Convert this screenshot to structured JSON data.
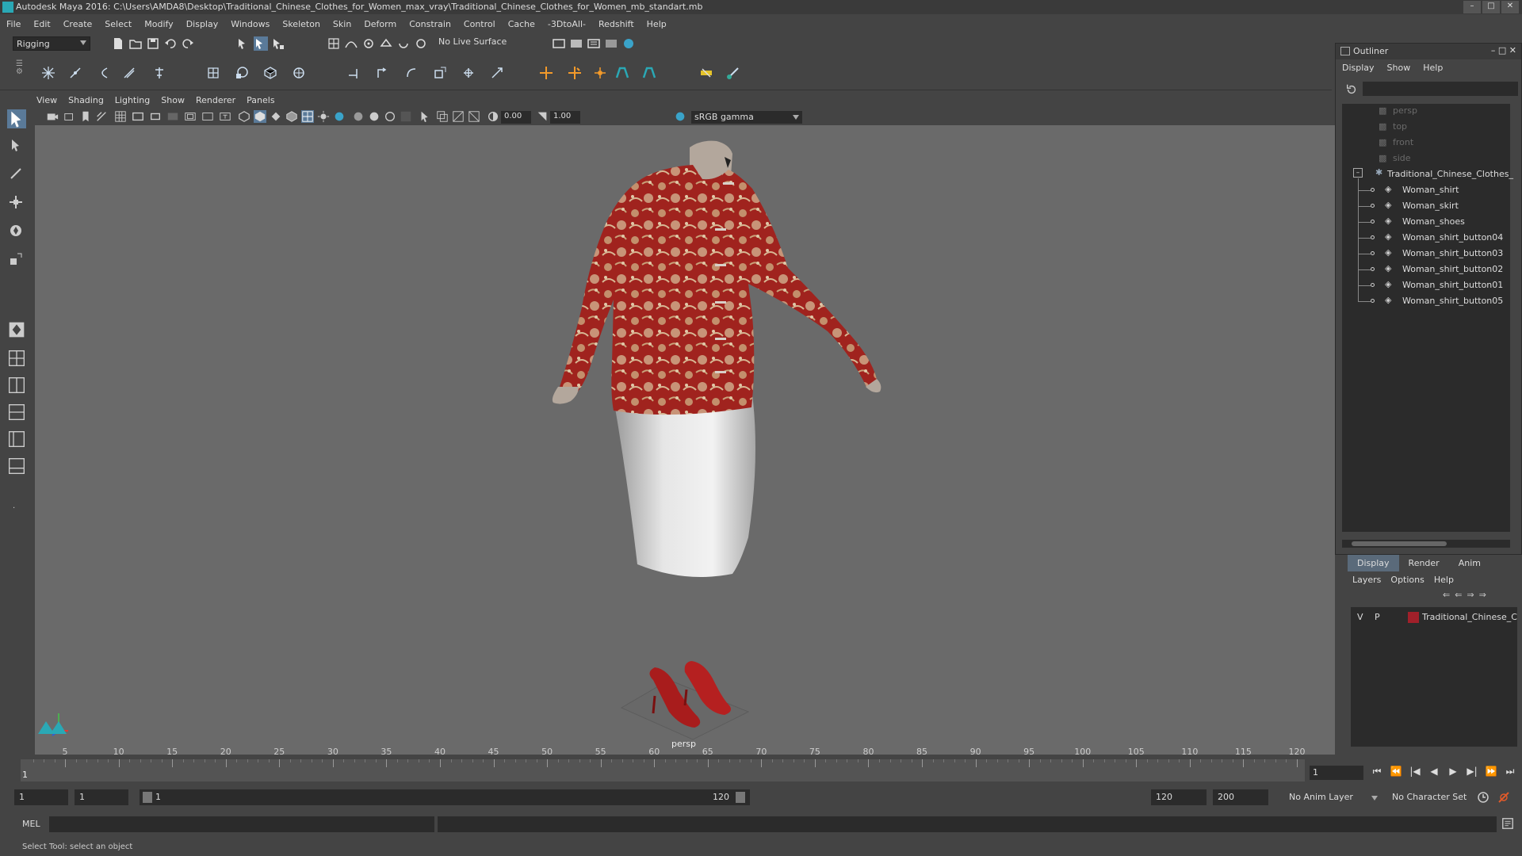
{
  "window": {
    "title": "Autodesk Maya 2016: C:\\Users\\AMDA8\\Desktop\\Traditional_Chinese_Clothes_for_Women_max_vray\\Traditional_Chinese_Clothes_for_Women_mb_standart.mb",
    "controls": [
      "–",
      "□",
      "✕"
    ]
  },
  "menubar": [
    "File",
    "Edit",
    "Create",
    "Select",
    "Modify",
    "Display",
    "Windows",
    "Skeleton",
    "Skin",
    "Deform",
    "Constrain",
    "Control",
    "Cache",
    "-3DtoAll-",
    "Redshift",
    "Help"
  ],
  "toolbar": {
    "mode": "Rigging",
    "live_surface": "No Live Surface"
  },
  "viewport": {
    "menu": [
      "View",
      "Shading",
      "Lighting",
      "Show",
      "Renderer",
      "Panels"
    ],
    "exposure": "0.00",
    "gamma": "1.00",
    "color_space": "sRGB gamma",
    "camera_label": "persp"
  },
  "outliner": {
    "title": "Outliner",
    "menu": [
      "Display",
      "Show",
      "Help"
    ],
    "cameras": [
      "persp",
      "top",
      "front",
      "side"
    ],
    "group": "Traditional_Chinese_Clothes_",
    "children": [
      "Woman_shirt",
      "Woman_skirt",
      "Woman_shoes",
      "Woman_shirt_button04",
      "Woman_shirt_button03",
      "Woman_shirt_button02",
      "Woman_shirt_button01",
      "Woman_shirt_button05"
    ]
  },
  "layer_editor": {
    "tabs": [
      "Display",
      "Render",
      "Anim"
    ],
    "menu": [
      "Layers",
      "Options",
      "Help"
    ],
    "layer": {
      "v": "V",
      "p": "P",
      "name": "Traditional_Chinese_Cl",
      "color": "#a0202a"
    }
  },
  "timeline": {
    "ticks": [
      "5",
      "10",
      "15",
      "20",
      "25",
      "30",
      "35",
      "40",
      "45",
      "50",
      "55",
      "60",
      "65",
      "70",
      "75",
      "80",
      "85",
      "90",
      "95",
      "100",
      "105",
      "110",
      "115",
      "120"
    ],
    "current_frame": "1",
    "frame_field": "1",
    "playback_buttons": [
      "⏮",
      "⏪",
      "|◀",
      "◀",
      "▶",
      "▶|",
      "⏩",
      "⏭"
    ]
  },
  "range": {
    "start": "1",
    "anim_start": "1",
    "slider_start": "1",
    "slider_end": "120",
    "end": "120",
    "anim_end": "200",
    "anim_layer": "No Anim Layer",
    "char_set": "No Character Set"
  },
  "cmdline": {
    "label": "MEL"
  },
  "status": {
    "text": "Select Tool: select an object"
  }
}
